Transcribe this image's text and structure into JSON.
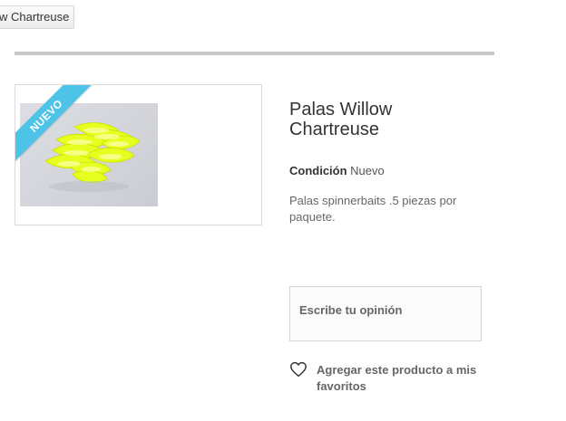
{
  "nav": {
    "back_label": "w Chartreuse"
  },
  "product": {
    "badge": "NUEVO",
    "title": "Palas Willow Chartreuse",
    "condition_label": "Condición",
    "condition_value": "Nuevo",
    "description": "Palas spinnerbaits .5 piezas por paquete.",
    "image_alt": "Palas Willow Chartreuse"
  },
  "actions": {
    "review_label": "Escribe tu opinión",
    "wishlist_label": "Agregar este producto a mis favoritos"
  },
  "colors": {
    "badge_bg": "#4ec3e8",
    "blade_color": "#e8ff2a",
    "divider": "#c8c8c8"
  }
}
